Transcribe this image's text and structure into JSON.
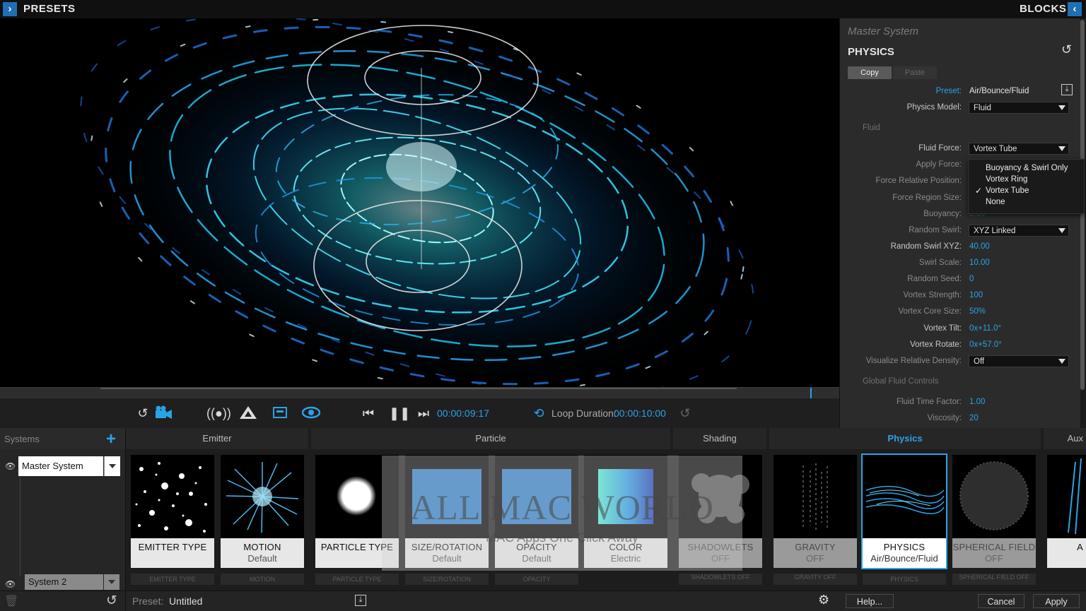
{
  "topbar": {
    "presets_label": "PRESETS",
    "blocks_label": "BLOCKS"
  },
  "transport": {
    "timecode": "00:00:09:17",
    "loop_label": "Loop Duration:",
    "loop_value": "00:00:10:00"
  },
  "panel": {
    "system_name": "Master System",
    "section_title": "PHYSICS",
    "copy_label": "Copy",
    "paste_label": "Paste",
    "preset_label": "Preset:",
    "preset_value": "Air/Bounce/Fluid",
    "physics_model_label": "Physics Model:",
    "physics_model_value": "Fluid",
    "fluid_section": "Fluid",
    "fluid_force_label": "Fluid Force:",
    "fluid_force_value": "Vortex Tube",
    "apply_force_label": "Apply Force:",
    "force_rel_pos_label": "Force Relative Position:",
    "force_region_size_label": "Force Region Size:",
    "buoyancy_label": "Buoyancy:",
    "buoyancy_value": "5.00",
    "random_swirl_label": "Random Swirl:",
    "random_swirl_value": "XYZ Linked",
    "random_swirl_xyz_label": "Random Swirl XYZ:",
    "random_swirl_xyz_value": "40.00",
    "swirl_scale_label": "Swirl Scale:",
    "swirl_scale_value": "10.00",
    "random_seed_label": "Random Seed:",
    "random_seed_value": "0",
    "vortex_strength_label": "Vortex Strength:",
    "vortex_strength_value": "100",
    "vortex_core_size_label": "Vortex Core Size:",
    "vortex_core_size_value": "50%",
    "vortex_tilt_label": "Vortex Tilt:",
    "vortex_tilt_value": "0x+11.0°",
    "vortex_rotate_label": "Vortex Rotate:",
    "vortex_rotate_value": "0x+57.0°",
    "visualize_density_label": "Visualize Relative Density:",
    "visualize_density_value": "Off",
    "global_section": "Global Fluid Controls",
    "fluid_time_factor_label": "Fluid Time Factor:",
    "fluid_time_factor_value": "1.00",
    "viscosity_label": "Viscosity:",
    "viscosity_value": "20",
    "dropdown_options": [
      "Buoyancy & Swirl Only",
      "Vortex Ring",
      "Vortex Tube",
      "None"
    ],
    "dropdown_checkmark": "✓"
  },
  "systems": {
    "title": "Systems",
    "master": "Master System",
    "system2": "System 2"
  },
  "categories": {
    "emitter": "Emitter",
    "particle": "Particle",
    "shading": "Shading",
    "physics": "Physics",
    "aux": "Aux"
  },
  "cards": [
    {
      "t1": "EMITTER TYPE",
      "t2": "",
      "sub": "EMITTER TYPE"
    },
    {
      "t1": "MOTION",
      "t2": "Default",
      "sub": "MOTION"
    },
    {
      "t1": "PARTICLE TYPE",
      "t2": "",
      "sub": "PARTICLE TYPE"
    },
    {
      "t1": "SIZE/ROTATION",
      "t2": "Default",
      "sub": "SIZE/ROTATION"
    },
    {
      "t1": "OPACITY",
      "t2": "Default",
      "sub": "OPACITY"
    },
    {
      "t1": "COLOR",
      "t2": "Electric",
      "sub": ""
    },
    {
      "t1": "SHADOWLETS",
      "t2": "OFF",
      "sub": "SHADOWLETS OFF"
    },
    {
      "t1": "GRAVITY",
      "t2": "OFF",
      "sub": "GRAVITY OFF"
    },
    {
      "t1": "PHYSICS",
      "t2": "Air/Bounce/Fluid",
      "sub": "PHYSICS"
    },
    {
      "t1": "SPHERICAL FIELD",
      "t2": "OFF",
      "sub": "SPHERICAL FIELD OFF"
    },
    {
      "t1": "A",
      "t2": "",
      "sub": ""
    }
  ],
  "watermark": {
    "line1": "ALL MAC WORLD",
    "line2": "MAC Apps One Click Away"
  },
  "statusbar": {
    "preset_label": "Preset:",
    "preset_value": "Untitled",
    "help": "Help...",
    "cancel": "Cancel",
    "apply": "Apply"
  },
  "colors": {
    "accent": "#2aa3e6",
    "panel_bg": "#2b2b2b"
  }
}
